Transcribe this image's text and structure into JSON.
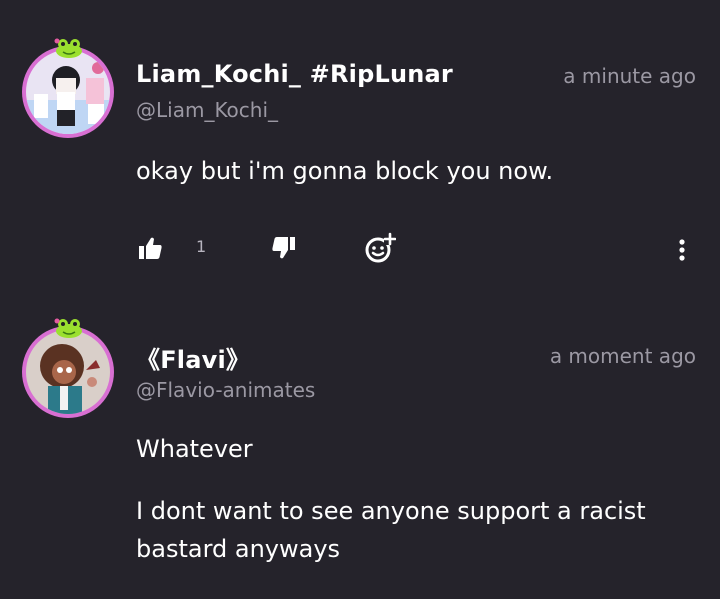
{
  "comments": [
    {
      "username": "Liam_Kochi_ #RipLunar",
      "handle": "@Liam_Kochi_",
      "time": "a minute ago",
      "text": "okay but i'm gonna block you now.",
      "likes": "1"
    },
    {
      "username": "《Flavi》",
      "handle": "@Flavio-animates",
      "time": "a moment ago",
      "paragraphs": [
        "Whatever",
        "I dont want to see anyone support a racist bastard anyways"
      ]
    }
  ],
  "colors": {
    "background": "#25232b",
    "secondary_text": "#9b98a3",
    "avatar_ring": "#d86fd2",
    "frog": "#9be02f"
  },
  "icons": [
    "frog-badge-icon",
    "thumbs-up-icon",
    "thumbs-down-icon",
    "add-reaction-icon",
    "more-options-icon"
  ]
}
